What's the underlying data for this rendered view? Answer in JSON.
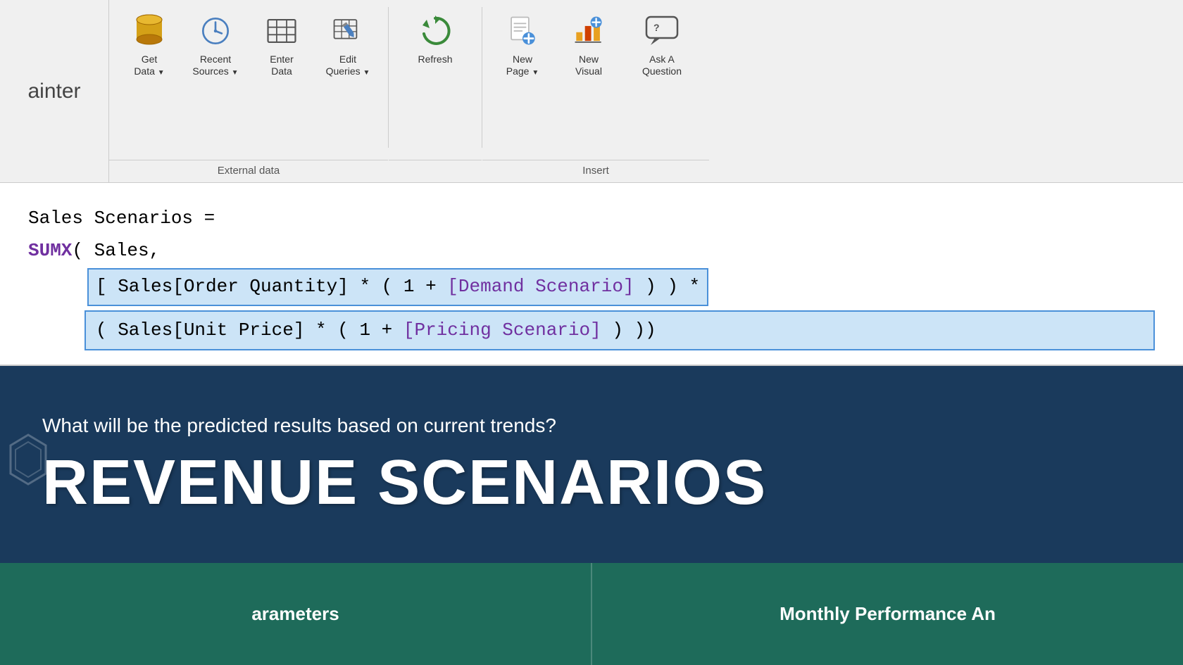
{
  "toolbar": {
    "left_label": "ainter",
    "groups": [
      {
        "name": "External data",
        "buttons": [
          {
            "id": "get-data",
            "label": "Get\nData",
            "has_arrow": true,
            "icon": "cylinder"
          },
          {
            "id": "recent-sources",
            "label": "Recent\nSources",
            "has_arrow": true,
            "icon": "clock"
          },
          {
            "id": "enter-data",
            "label": "Enter\nData",
            "has_arrow": false,
            "icon": "table"
          },
          {
            "id": "edit-queries",
            "label": "Edit\nQueries",
            "has_arrow": true,
            "icon": "table-edit"
          }
        ]
      },
      {
        "name": "",
        "buttons": [
          {
            "id": "refresh",
            "label": "Refresh",
            "has_arrow": false,
            "icon": "refresh"
          }
        ]
      },
      {
        "name": "Insert",
        "buttons": [
          {
            "id": "new-page",
            "label": "New\nPage",
            "has_arrow": true,
            "icon": "new-page"
          },
          {
            "id": "new-visual",
            "label": "New\nVisual",
            "has_arrow": false,
            "icon": "new-visual"
          },
          {
            "id": "ask-question",
            "label": "Ask A\nQuestion",
            "has_arrow": false,
            "icon": "chat"
          }
        ]
      }
    ]
  },
  "code": {
    "line1": "Sales Scenarios =",
    "line2_func": "SUMX",
    "line2_rest": "( Sales,",
    "line3_selected": "[ Sales[Order Quantity] * ( 1 + [Demand Scenario] ) ) *",
    "line4_selected": "( Sales[Unit Price] * ( 1 + [Pricing Scenario] ) ))",
    "demand_scenario": "[Demand Scenario]",
    "pricing_scenario": "[Pricing Scenario]"
  },
  "banner": {
    "subtitle": "What will be the predicted results based on current trends?",
    "title": "REVENUE SCENARIOS"
  },
  "bottom": {
    "card1_text": "arameters",
    "card2_text": "Monthly Performance An"
  }
}
